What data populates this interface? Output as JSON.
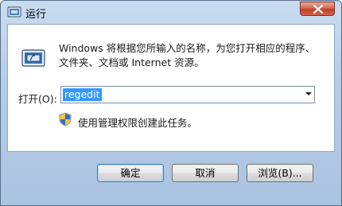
{
  "window": {
    "title": "运行",
    "close_label": "关闭"
  },
  "dialog": {
    "description": "Windows 将根据您所输入的名称，为您打开相应的程序、文件夹、文档或 Internet 资源。",
    "open_label": "打开(O):",
    "open_value": "regedit",
    "admin_note": "使用管理权限创建此任务。"
  },
  "buttons": {
    "ok": "确定",
    "cancel": "取消",
    "browse": "浏览(B)..."
  },
  "colors": {
    "selection": "#3399ff",
    "close_button": "#c2402a",
    "frame": "#b7cde6"
  },
  "icons": [
    "run-icon",
    "shield-icon",
    "close-icon",
    "chevron-down-icon"
  ]
}
